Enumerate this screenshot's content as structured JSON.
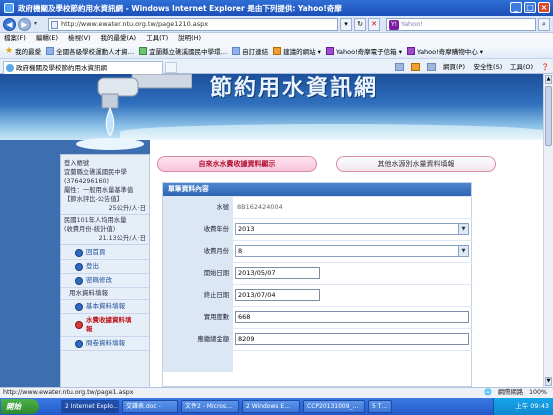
{
  "window": {
    "title": "政府機關及學校節約用水資訊網 - Windows Internet Explorer 是由下列提供: Yahoo!奇摩"
  },
  "address": {
    "url": "http://www.ewater.ntu.org.tw/page1210.aspx",
    "search_placeholder": "Yahoo!"
  },
  "menu": [
    "檔案(F)",
    "編輯(E)",
    "檢視(V)",
    "我的最愛(A)",
    "工具(T)",
    "說明(H)"
  ],
  "favorites": [
    {
      "label": "我的最愛"
    },
    {
      "label": "全國各級學校運動人才資…"
    },
    {
      "label": "宜蘭縣立礁溪國民中學環…"
    },
    {
      "label": "自訂連結"
    },
    {
      "label": "建議的網站 ▾"
    },
    {
      "label": "Yahoo!奇摩電子信箱 ▾"
    },
    {
      "label": "Yahoo!奇摩購物中心 ▾"
    }
  ],
  "tab": {
    "label": "政府機關及學校節約用水資訊網"
  },
  "commands": {
    "page": "網頁(P) ▾",
    "safety": "安全性(S) ▾",
    "tools": "工具(O) ▾",
    "help": "❓ ▾"
  },
  "banner": {
    "title": "節約用水資訊網"
  },
  "left": {
    "login_status": "登入帳號",
    "school": "宜蘭縣立礁溪國民中學",
    "code": "(3764296160)",
    "standard": "屬性：一般用水量基準值",
    "standard2": "【節水評比-公告值】",
    "standard2_date": "25公升/人·日",
    "year_value": "民國101年人均用水量",
    "year_value2": "(收費月份-統計值)",
    "year_value2_num": "21.13公升/人·日",
    "links": {
      "home": "回首頁",
      "logout": "登出",
      "password": "密碼修改",
      "usage_title": "用水資料填報",
      "basic": "基本資料填報",
      "fee": "水費收據資料填報",
      "meter": "問卷資料填報"
    }
  },
  "main": {
    "pill1": "自來水水費收據資料顯示",
    "pill2": "其他水源別水量資料填報",
    "form_head": "單筆資料內容",
    "fields": {
      "serial_label": "水號",
      "serial_value": "8B162424004",
      "year_label": "收費年份",
      "year_value": "2013",
      "month_label": "收費月份",
      "month_value": "8",
      "start_label": "開始日期",
      "start_value": "2013/05/07",
      "end_label": "終止日期",
      "end_value": "2013/07/04",
      "usage_label": "實用度數",
      "usage_value": "668",
      "amount_label": "應繳總金額",
      "amount_value": "8209"
    }
  },
  "status": {
    "url": "http://www.ewater.ntu.org.tw/page1.aspx",
    "zone": "網際網路",
    "zoom": "100%"
  },
  "taskbar": {
    "start": "開始",
    "tasks": [
      "2 Internet Explo…",
      "交謙表.doc -",
      "文件2 - Micros…",
      "2 Windows E…",
      "CCP20131009_…",
      "5 T…"
    ],
    "clock": "上午 09:43"
  }
}
